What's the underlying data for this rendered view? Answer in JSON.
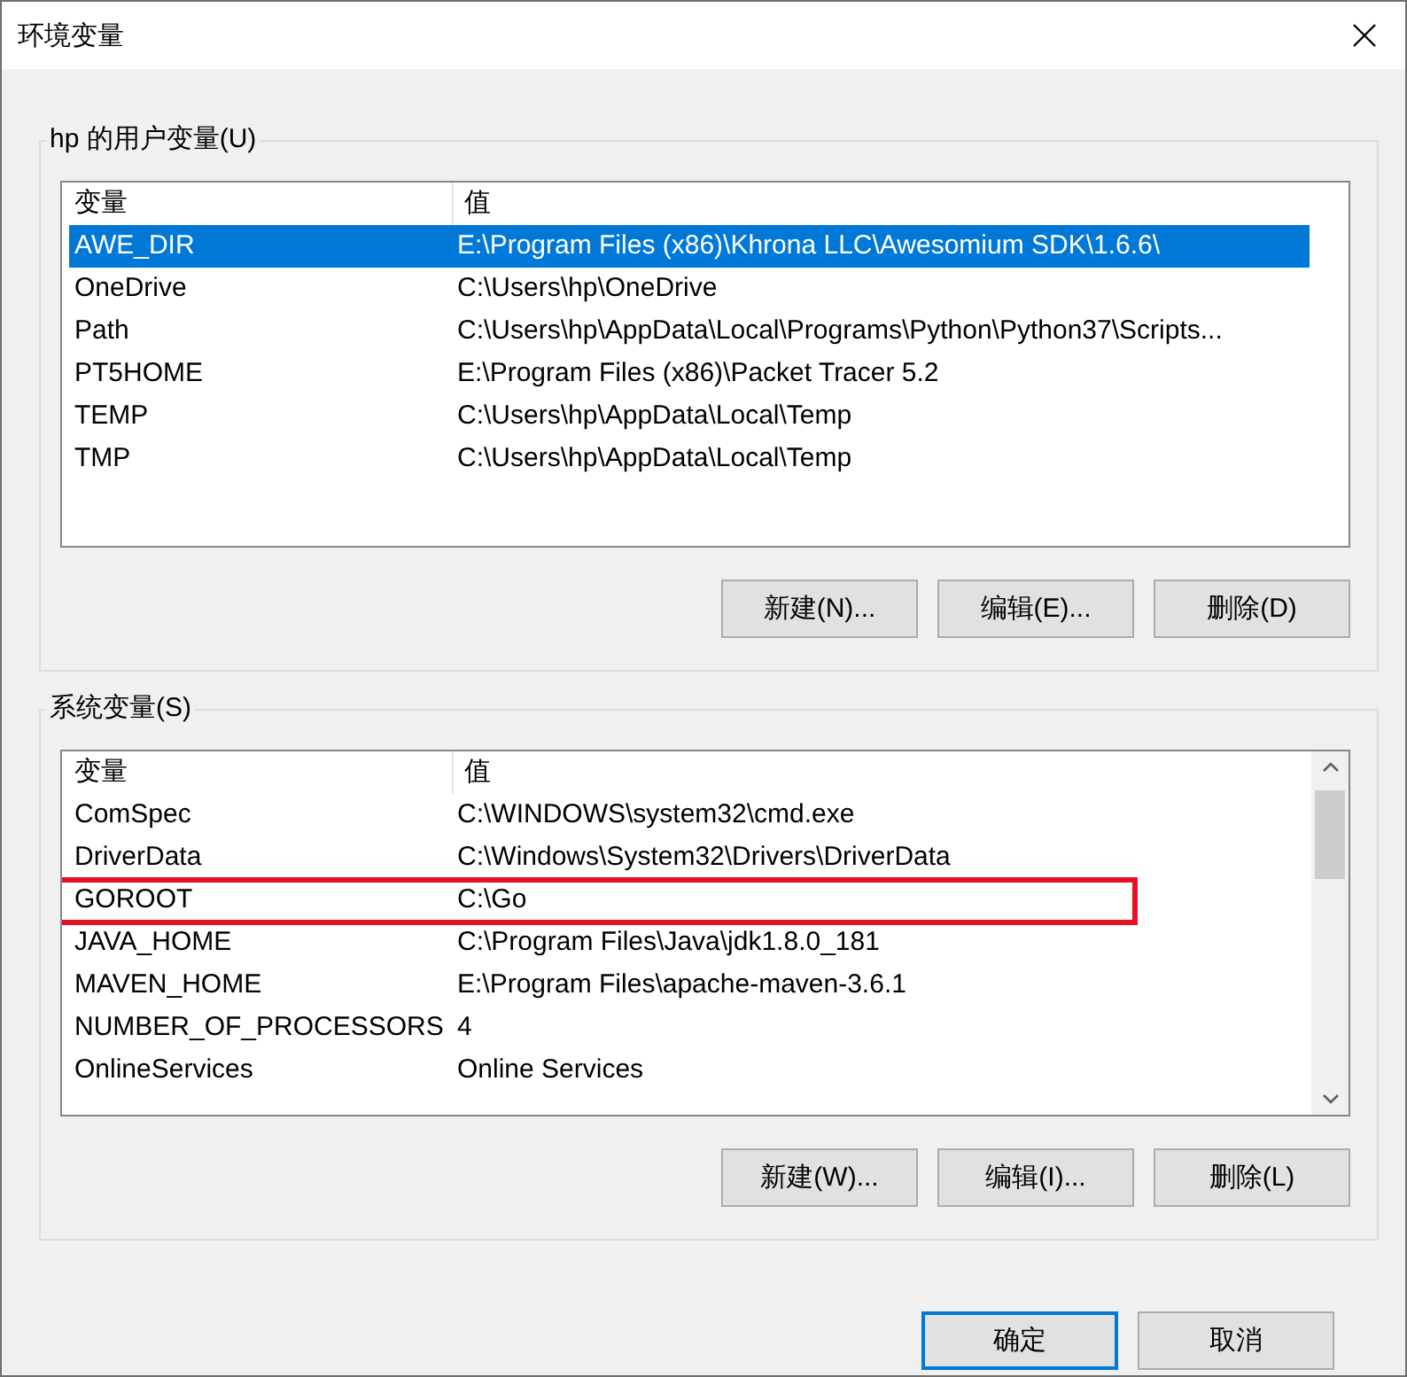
{
  "window": {
    "title": "环境变量"
  },
  "user_vars": {
    "label": "hp 的用户变量(U)",
    "columns": [
      "变量",
      "值"
    ],
    "rows": [
      {
        "name": "AWE_DIR",
        "value": "E:\\Program Files (x86)\\Khrona LLC\\Awesomium SDK\\1.6.6\\",
        "selected": true,
        "highlighted": false
      },
      {
        "name": "OneDrive",
        "value": "C:\\Users\\hp\\OneDrive",
        "selected": false,
        "highlighted": false
      },
      {
        "name": "Path",
        "value": "C:\\Users\\hp\\AppData\\Local\\Programs\\Python\\Python37\\Scripts...",
        "selected": false,
        "highlighted": false
      },
      {
        "name": "PT5HOME",
        "value": "E:\\Program Files (x86)\\Packet Tracer 5.2",
        "selected": false,
        "highlighted": false
      },
      {
        "name": "TEMP",
        "value": "C:\\Users\\hp\\AppData\\Local\\Temp",
        "selected": false,
        "highlighted": false
      },
      {
        "name": "TMP",
        "value": "C:\\Users\\hp\\AppData\\Local\\Temp",
        "selected": false,
        "highlighted": false
      }
    ],
    "buttons": [
      "新建(N)...",
      "编辑(E)...",
      "删除(D)"
    ],
    "scrollbar": false
  },
  "system_vars": {
    "label": "系统变量(S)",
    "columns": [
      "变量",
      "值"
    ],
    "rows": [
      {
        "name": "ComSpec",
        "value": "C:\\WINDOWS\\system32\\cmd.exe",
        "selected": false,
        "highlighted": false
      },
      {
        "name": "DriverData",
        "value": "C:\\Windows\\System32\\Drivers\\DriverData",
        "selected": false,
        "highlighted": false
      },
      {
        "name": "GOROOT",
        "value": "C:\\Go",
        "selected": false,
        "highlighted": true
      },
      {
        "name": "JAVA_HOME",
        "value": "C:\\Program Files\\Java\\jdk1.8.0_181",
        "selected": false,
        "highlighted": false
      },
      {
        "name": "MAVEN_HOME",
        "value": "E:\\Program Files\\apache-maven-3.6.1",
        "selected": false,
        "highlighted": false
      },
      {
        "name": "NUMBER_OF_PROCESSORS",
        "value": "4",
        "selected": false,
        "highlighted": false
      },
      {
        "name": "OnlineServices",
        "value": "Online Services",
        "selected": false,
        "highlighted": false
      }
    ],
    "buttons": [
      "新建(W)...",
      "编辑(I)...",
      "删除(L)"
    ],
    "scrollbar": true
  },
  "footer_buttons": [
    {
      "label": "确定",
      "default": true
    },
    {
      "label": "取消",
      "default": false
    }
  ]
}
